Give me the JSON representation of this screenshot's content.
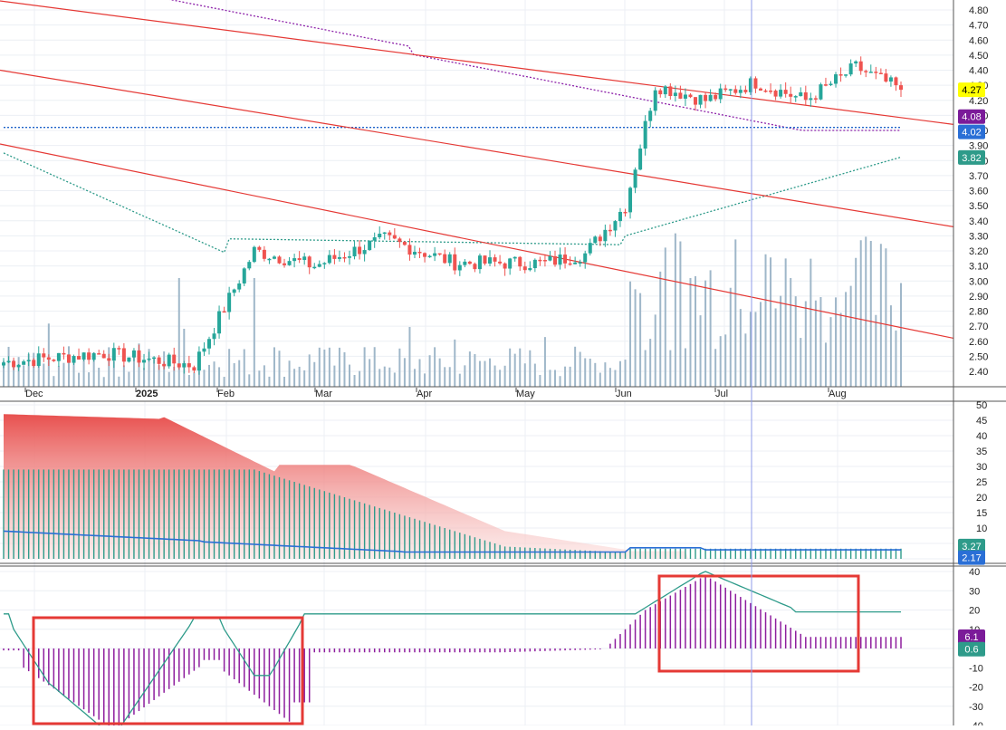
{
  "chart_data": [
    {
      "type": "candlestick",
      "panel": "price",
      "ylim": [
        2.35,
        4.85
      ],
      "y_ticks": [
        "2.40",
        "2.50",
        "2.60",
        "2.70",
        "2.80",
        "2.90",
        "3.00",
        "3.10",
        "3.20",
        "3.30",
        "3.40",
        "3.50",
        "3.60",
        "3.70",
        "3.80",
        "3.90",
        "4.00",
        "4.10",
        "4.20",
        "4.30",
        "4.40",
        "4.50",
        "4.60",
        "4.70",
        "4.80"
      ],
      "x_ticks": [
        "Dec",
        "2025",
        "Feb",
        "Mar",
        "Apr",
        "May",
        "Jun",
        "Jul",
        "Aug"
      ],
      "value_tags": [
        {
          "label": "4.27",
          "value": 4.27,
          "color": "#ffff00",
          "text_color": "#000000"
        },
        {
          "label": "4.08",
          "value": 4.08,
          "color": "#7b1b99",
          "text_color": "#ffffff"
        },
        {
          "label": "4.02",
          "value": 4.02,
          "color": "#2a6fd6",
          "text_color": "#ffffff"
        },
        {
          "label": "3.82",
          "value": 3.82,
          "color": "#2e9b8a",
          "text_color": "#ffffff"
        }
      ],
      "candles_anchor_closes": [
        {
          "period": "Dec",
          "close": 2.46
        },
        {
          "period": "2025",
          "close": 2.55
        },
        {
          "period": "Feb",
          "close": 3.15
        },
        {
          "period": "Mar",
          "close": 3.1
        },
        {
          "period": "Apr",
          "close": 3.2
        },
        {
          "period": "May",
          "close": 3.12
        },
        {
          "period": "Jun",
          "close": 3.18
        },
        {
          "period": "Jul",
          "close": 4.35
        },
        {
          "period": "Aug",
          "close": 4.35
        }
      ],
      "last_close": 4.27,
      "colors": {
        "up": "#26a69a",
        "down": "#ef5350",
        "trendline": "#e53935",
        "purple_band": "#8e24aa",
        "blue_band": "#1e63c9",
        "teal_band": "#2e9b8a",
        "volume": "#9fb7c9",
        "crosshair": "#8f9be8"
      }
    },
    {
      "type": "area+histogram",
      "panel": "indicator_1",
      "ylim": [
        0,
        50
      ],
      "y_ticks": [
        "0",
        "5",
        "10",
        "15",
        "20",
        "25",
        "30",
        "35",
        "40",
        "45",
        "50"
      ],
      "value_tags": [
        {
          "label": "3.27",
          "value": 3.27,
          "color": "#2e9b8a",
          "text_color": "#ffffff"
        },
        {
          "label": "2.17",
          "value": 2.17,
          "color": "#2a6fd6",
          "text_color": "#ffffff"
        }
      ]
    },
    {
      "type": "line+histogram",
      "panel": "indicator_2",
      "ylim": [
        -40,
        45
      ],
      "y_ticks": [
        "40",
        "30",
        "20",
        "10",
        "0",
        "-10",
        "-20",
        "-30",
        "-40"
      ],
      "value_tags": [
        {
          "label": "6.1",
          "value": 6.1,
          "color": "#7b1b99",
          "text_color": "#ffffff"
        },
        {
          "label": "0.6",
          "value": 0.6,
          "color": "#2e9b8a",
          "text_color": "#ffffff"
        }
      ],
      "highlight_boxes": [
        {
          "from_period": "Dec",
          "to_period": "Mar",
          "color": "#e53935"
        },
        {
          "from_period": "Jul",
          "to_period": "Aug",
          "color": "#e53935"
        }
      ]
    }
  ]
}
